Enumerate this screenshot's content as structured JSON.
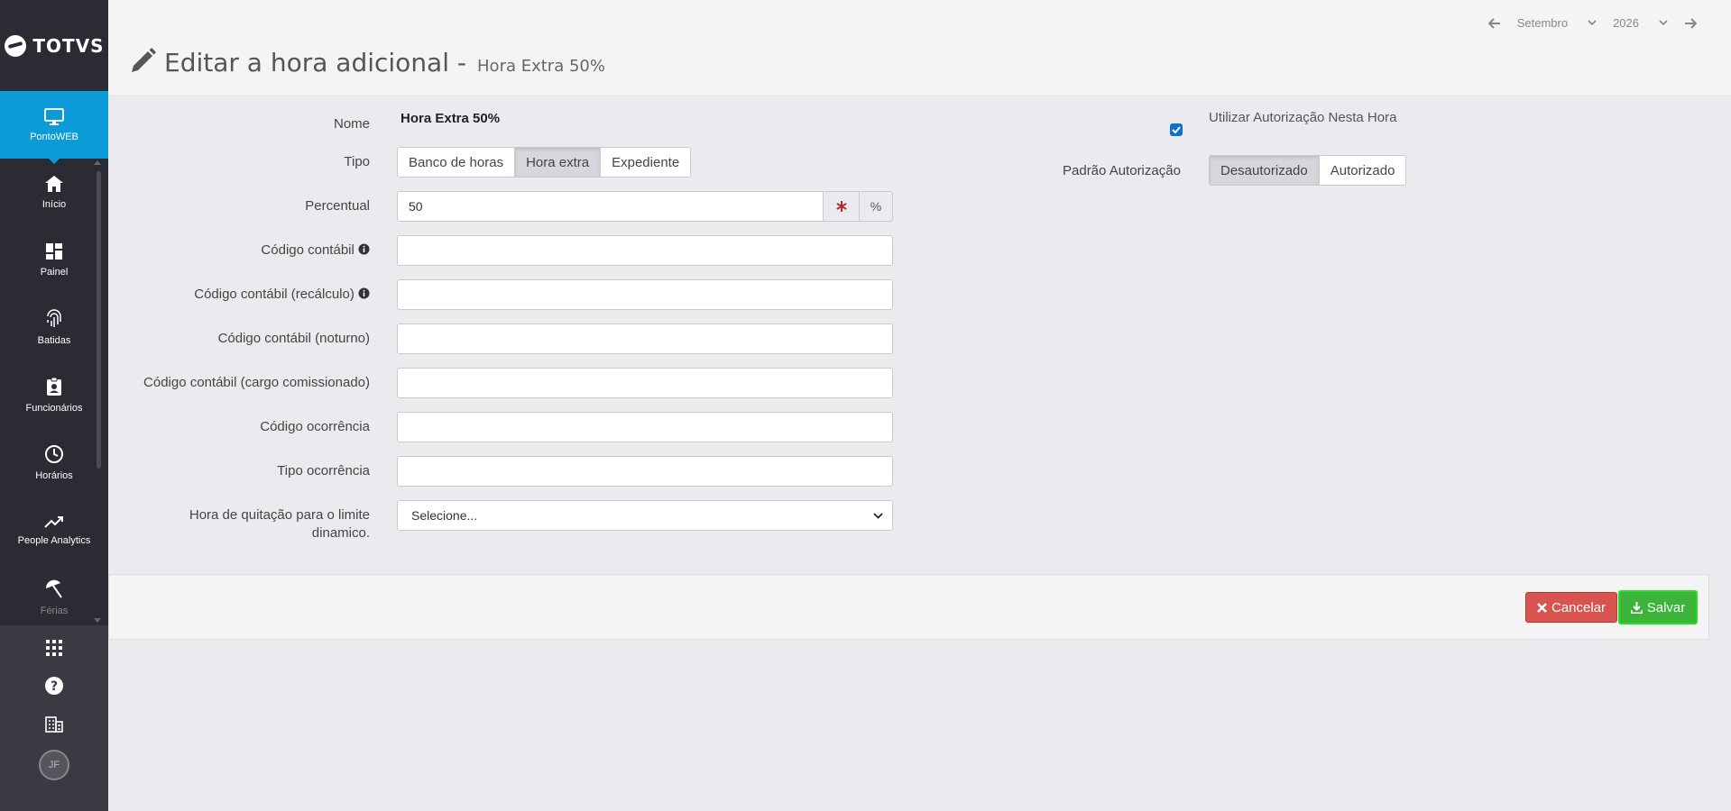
{
  "brand": {
    "logo_text": "TOTVS"
  },
  "module": {
    "label": "PontoWEB"
  },
  "nav": [
    {
      "label": "Início",
      "icon": "home-icon"
    },
    {
      "label": "Painel",
      "icon": "dashboard-icon"
    },
    {
      "label": "Batidas",
      "icon": "fingerprint-icon"
    },
    {
      "label": "Funcionários",
      "icon": "badge-icon"
    },
    {
      "label": "Horários",
      "icon": "clock-icon"
    },
    {
      "label": "People Analytics",
      "icon": "trend-icon"
    },
    {
      "label": "Férias",
      "icon": "beach-umbrella-icon"
    }
  ],
  "sidebar_bottom": {
    "avatar_initials": "JF"
  },
  "header": {
    "title": "Editar a hora adicional -",
    "subtitle": "Hora Extra 50%",
    "month": "Setembro",
    "year": "2026"
  },
  "form": {
    "nome_label": "Nome",
    "nome_value": "Hora Extra 50%",
    "tipo_label": "Tipo",
    "tipo_options": [
      "Banco de horas",
      "Hora extra",
      "Expediente"
    ],
    "tipo_selected": "Hora extra",
    "percentual_label": "Percentual",
    "percentual_value": "50",
    "percentual_suffix": "%",
    "codigo_contabil_label": "Código contábil",
    "codigo_contabil_recalculo_label": "Código contábil (recálculo)",
    "codigo_contabil_noturno_label": "Código contábil (noturno)",
    "codigo_contabil_cargo_label": "Código contábil (cargo comissionado)",
    "codigo_ocorrencia_label": "Código ocorrência",
    "tipo_ocorrencia_label": "Tipo ocorrência",
    "hora_quitacao_label_1": "Hora de quitação para o limite",
    "hora_quitacao_label_2": "dinamico.",
    "hora_quitacao_placeholder": "Selecione...",
    "utilizar_autorizacao_label": "Utilizar Autorização Nesta Hora",
    "utilizar_autorizacao_checked": true,
    "padrao_autorizacao_label": "Padrão Autorização",
    "padrao_options": [
      "Desautorizado",
      "Autorizado"
    ],
    "padrao_selected": "Desautorizado"
  },
  "actions": {
    "cancel_label": "Cancelar",
    "save_label": "Salvar"
  },
  "colors": {
    "sidebar": "#2b2c33",
    "accent": "#0b9bd8",
    "cancel": "#d9534f",
    "save": "#3cb43c"
  }
}
